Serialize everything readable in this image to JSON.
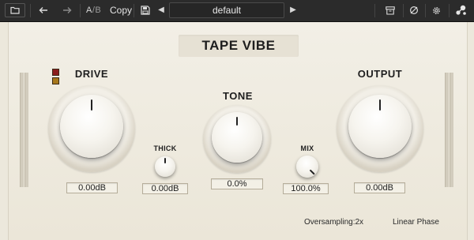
{
  "toolbar": {
    "ab_a": "A",
    "ab_sep": "/",
    "ab_b": "B",
    "copy_label": "Copy",
    "preset_name": "default",
    "prev_arrow": "◀",
    "next_arrow": "▶"
  },
  "plugin": {
    "title": "TAPE VIBE",
    "drive": {
      "label": "DRIVE",
      "value": "0.00dB"
    },
    "thick": {
      "label": "THICK",
      "value": "0.00dB"
    },
    "tone": {
      "label": "TONE",
      "value": "0.0%"
    },
    "mix": {
      "label": "MIX",
      "value": "100.0%"
    },
    "output": {
      "label": "OUTPUT",
      "value": "0.00dB"
    }
  },
  "footer": {
    "oversampling": "Oversampling:2x",
    "phase_mode": "Linear Phase"
  },
  "colors": {
    "toolbar_bg": "#2b2b2b",
    "panel_bg": "#efebe1",
    "indicator_red": "#8b1e1e",
    "indicator_amber": "#a7781c"
  },
  "icons": {
    "folder": "folder-icon",
    "undo": "undo-icon",
    "redo": "redo-icon",
    "save": "save-icon",
    "archive": "archive-icon",
    "bypass": "bypass-icon",
    "settings": "gear-icon",
    "logo": "logo-icon"
  }
}
